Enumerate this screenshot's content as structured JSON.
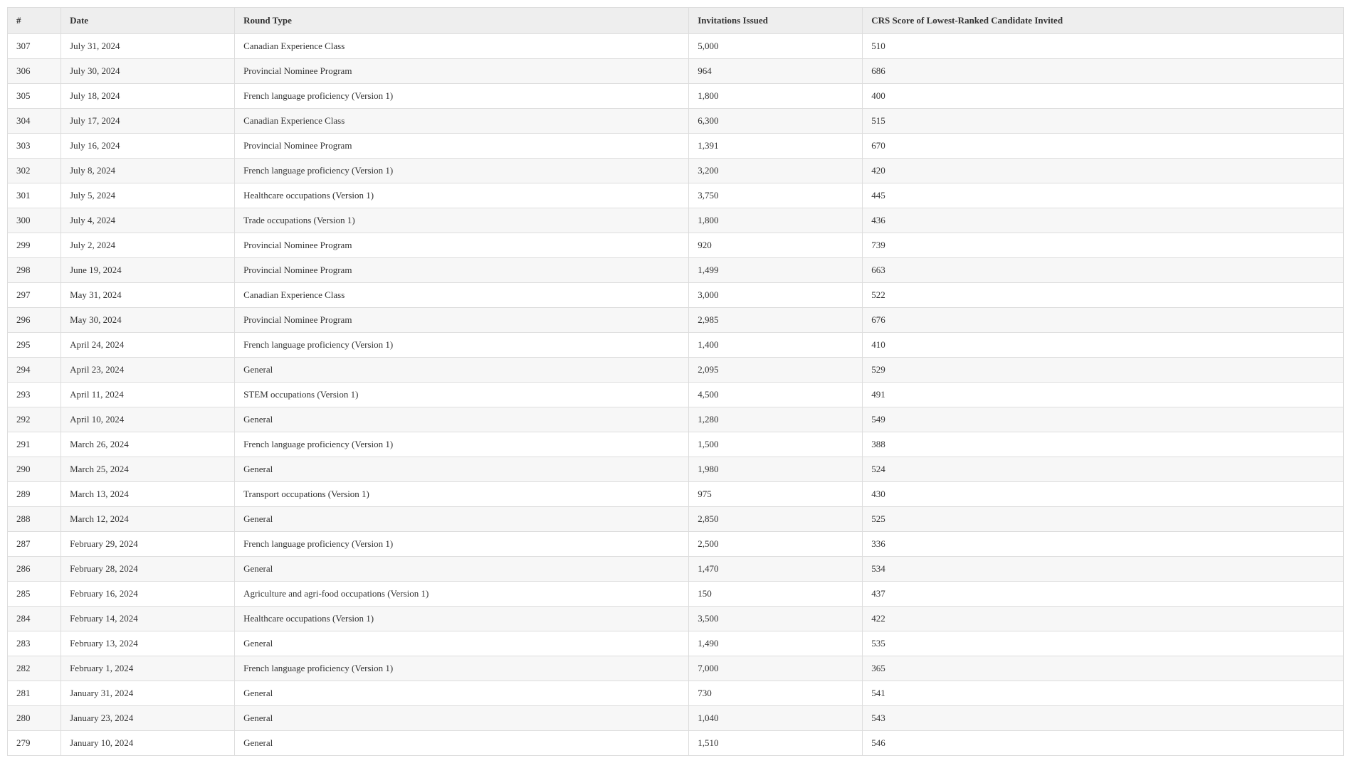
{
  "table": {
    "headers": [
      "#",
      "Date",
      "Round Type",
      "Invitations Issued",
      "CRS Score of Lowest-Ranked Candidate Invited"
    ],
    "rows": [
      {
        "num": "307",
        "date": "July 31, 2024",
        "type": "Canadian Experience Class",
        "invitations": "5,000",
        "crs": "510"
      },
      {
        "num": "306",
        "date": "July 30, 2024",
        "type": "Provincial Nominee Program",
        "invitations": "964",
        "crs": "686"
      },
      {
        "num": "305",
        "date": "July 18, 2024",
        "type": "French language proficiency (Version 1)",
        "invitations": "1,800",
        "crs": "400"
      },
      {
        "num": "304",
        "date": "July 17, 2024",
        "type": "Canadian Experience Class",
        "invitations": "6,300",
        "crs": "515"
      },
      {
        "num": "303",
        "date": "July 16, 2024",
        "type": "Provincial Nominee Program",
        "invitations": "1,391",
        "crs": "670"
      },
      {
        "num": "302",
        "date": "July 8, 2024",
        "type": "French language proficiency (Version 1)",
        "invitations": "3,200",
        "crs": "420"
      },
      {
        "num": "301",
        "date": "July 5, 2024",
        "type": "Healthcare occupations (Version 1)",
        "invitations": "3,750",
        "crs": "445"
      },
      {
        "num": "300",
        "date": "July 4, 2024",
        "type": "Trade occupations (Version 1)",
        "invitations": "1,800",
        "crs": "436"
      },
      {
        "num": "299",
        "date": "July 2, 2024",
        "type": "Provincial Nominee Program",
        "invitations": "920",
        "crs": "739"
      },
      {
        "num": "298",
        "date": "June 19, 2024",
        "type": "Provincial Nominee Program",
        "invitations": "1,499",
        "crs": "663"
      },
      {
        "num": "297",
        "date": "May 31, 2024",
        "type": "Canadian Experience Class",
        "invitations": "3,000",
        "crs": "522"
      },
      {
        "num": "296",
        "date": "May 30, 2024",
        "type": "Provincial Nominee Program",
        "invitations": "2,985",
        "crs": "676"
      },
      {
        "num": "295",
        "date": "April 24, 2024",
        "type": "French language proficiency (Version 1)",
        "invitations": "1,400",
        "crs": "410"
      },
      {
        "num": "294",
        "date": "April 23, 2024",
        "type": "General",
        "invitations": "2,095",
        "crs": "529"
      },
      {
        "num": "293",
        "date": "April 11, 2024",
        "type": "STEM occupations (Version 1)",
        "invitations": "4,500",
        "crs": "491"
      },
      {
        "num": "292",
        "date": "April 10, 2024",
        "type": "General",
        "invitations": "1,280",
        "crs": "549"
      },
      {
        "num": "291",
        "date": "March 26, 2024",
        "type": "French language proficiency (Version 1)",
        "invitations": "1,500",
        "crs": "388"
      },
      {
        "num": "290",
        "date": "March 25, 2024",
        "type": "General",
        "invitations": "1,980",
        "crs": "524"
      },
      {
        "num": "289",
        "date": "March 13, 2024",
        "type": "Transport occupations (Version 1)",
        "invitations": "975",
        "crs": "430"
      },
      {
        "num": "288",
        "date": "March 12, 2024",
        "type": "General",
        "invitations": "2,850",
        "crs": "525"
      },
      {
        "num": "287",
        "date": "February 29, 2024",
        "type": "French language proficiency (Version 1)",
        "invitations": "2,500",
        "crs": "336"
      },
      {
        "num": "286",
        "date": "February 28, 2024",
        "type": "General",
        "invitations": "1,470",
        "crs": "534"
      },
      {
        "num": "285",
        "date": "February 16, 2024",
        "type": "Agriculture and agri-food occupations (Version 1)",
        "invitations": "150",
        "crs": "437"
      },
      {
        "num": "284",
        "date": "February 14, 2024",
        "type": "Healthcare occupations (Version 1)",
        "invitations": "3,500",
        "crs": "422"
      },
      {
        "num": "283",
        "date": "February 13, 2024",
        "type": "General",
        "invitations": "1,490",
        "crs": "535"
      },
      {
        "num": "282",
        "date": "February 1, 2024",
        "type": "French language proficiency (Version 1)",
        "invitations": "7,000",
        "crs": "365"
      },
      {
        "num": "281",
        "date": "January 31, 2024",
        "type": "General",
        "invitations": "730",
        "crs": "541"
      },
      {
        "num": "280",
        "date": "January 23, 2024",
        "type": "General",
        "invitations": "1,040",
        "crs": "543"
      },
      {
        "num": "279",
        "date": "January 10, 2024",
        "type": "General",
        "invitations": "1,510",
        "crs": "546"
      }
    ]
  }
}
